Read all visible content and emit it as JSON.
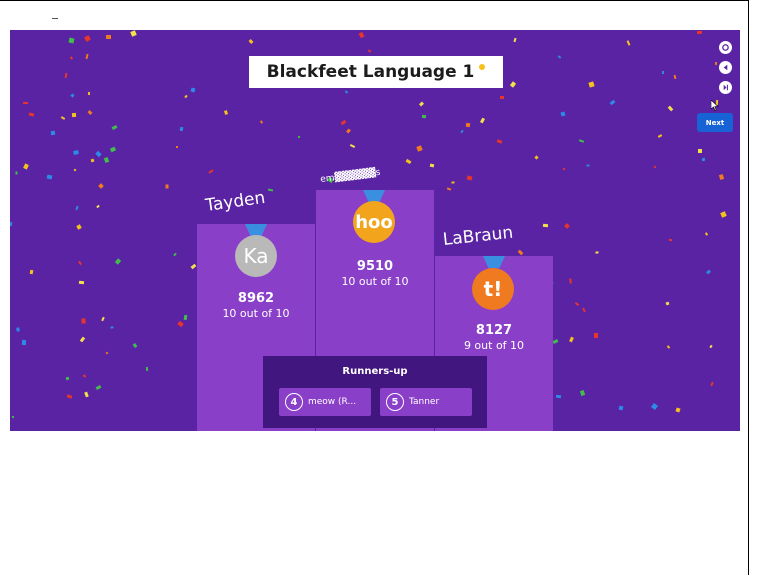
{
  "header": {
    "title": "Blackfeet Language 1"
  },
  "controls": {
    "icons": [
      "fullscreen-icon",
      "back-icon",
      "skip-icon"
    ],
    "next_label": "Next"
  },
  "podium": [
    {
      "place": 2,
      "name": "Tayden",
      "avatar_text": "Ka",
      "avatar_color": "#b9b9b9",
      "score": "8962",
      "correct": "10 out of 10"
    },
    {
      "place": 1,
      "name": "em▓▓▓▓▓▓s",
      "avatar_text": "hoo",
      "avatar_color": "#f2a51c",
      "score": "9510",
      "correct": "10 out of 10"
    },
    {
      "place": 3,
      "name": "LaBraun",
      "avatar_text": "t!",
      "avatar_color": "#f07a1f",
      "score": "8127",
      "correct": "9 out of 10"
    }
  ],
  "runners_up": {
    "title": "Runners-up",
    "items": [
      {
        "rank": "4",
        "name": "meow (R..."
      },
      {
        "rank": "5",
        "name": "Tanner"
      }
    ]
  },
  "colors": {
    "stage": "#5a23a4",
    "podium": "#8a3fc8",
    "panel": "#42167f",
    "accent": "#1763d6"
  }
}
